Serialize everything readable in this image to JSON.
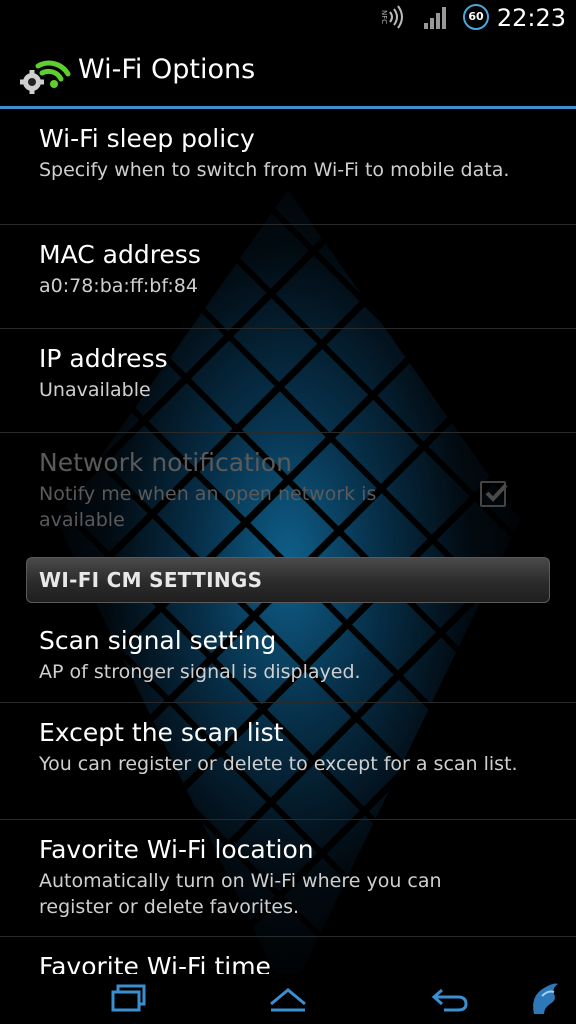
{
  "status_bar": {
    "time": "22:23",
    "badge_text": "60",
    "nfc_text": "NFC",
    "icons": [
      "nfc-icon",
      "signal-icon",
      "badge-icon"
    ]
  },
  "action_bar": {
    "title": "Wi-Fi Options",
    "icon": "wifi-settings-icon"
  },
  "settings": [
    {
      "title": "Wi-Fi sleep policy",
      "summary": "Specify when to switch from Wi-Fi to mobile data.",
      "enabled": true
    },
    {
      "title": "MAC address",
      "summary": "a0:78:ba:ff:bf:84",
      "enabled": true
    },
    {
      "title": "IP address",
      "summary": "Unavailable",
      "enabled": true
    },
    {
      "title": "Network notification",
      "summary": "Notify me when an open network is available",
      "enabled": false,
      "checked": true
    }
  ],
  "section_header": "WI-FI CM SETTINGS",
  "cm_settings": [
    {
      "title": "Scan signal setting",
      "summary": "AP of stronger signal is displayed."
    },
    {
      "title": "Except the scan list",
      "summary": "You can register or delete to except for a scan list."
    },
    {
      "title": "Favorite Wi-Fi location",
      "summary": "Automatically turn on Wi-Fi where you can register or delete favorites."
    },
    {
      "title": "Favorite Wi-Fi time",
      "summary": ""
    }
  ],
  "nav_bar": {
    "buttons": [
      "recent-apps-icon",
      "home-icon",
      "back-icon",
      "app-logo-icon"
    ]
  },
  "colors": {
    "accent": "#3a8fd0",
    "background": "#000000"
  }
}
